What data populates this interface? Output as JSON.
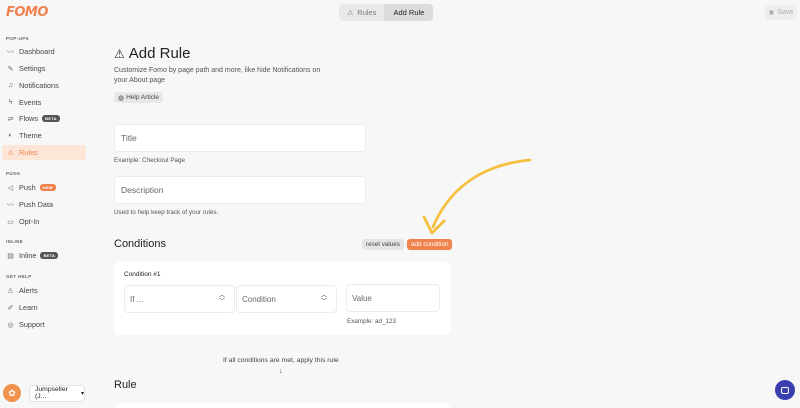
{
  "brand": {
    "logo": "FOMO",
    "accent": "#f0824e"
  },
  "sidebar": {
    "sections": [
      {
        "label": "POP-UPS",
        "items": [
          {
            "label": "Dashboard",
            "icon": "chart-line-icon"
          },
          {
            "label": "Settings",
            "icon": "pencil-icon"
          },
          {
            "label": "Notifications",
            "icon": "bell-icon"
          },
          {
            "label": "Events",
            "icon": "bolt-icon"
          },
          {
            "label": "Flows",
            "icon": "flow-icon",
            "badge": "BETA"
          },
          {
            "label": "Theme",
            "icon": "palette-icon"
          },
          {
            "label": "Rules",
            "icon": "warning-icon",
            "active": true
          }
        ]
      },
      {
        "label": "PUSH",
        "items": [
          {
            "label": "Push",
            "icon": "megaphone-icon",
            "badge": "NEW"
          },
          {
            "label": "Push Data",
            "icon": "chart-line-icon"
          },
          {
            "label": "Opt-In",
            "icon": "window-icon"
          }
        ]
      },
      {
        "label": "INLINE",
        "items": [
          {
            "label": "Inline",
            "icon": "inline-icon",
            "badge": "BETA"
          }
        ]
      },
      {
        "label": "GET HELP",
        "items": [
          {
            "label": "Alerts",
            "icon": "alert-icon"
          },
          {
            "label": "Learn",
            "icon": "book-icon"
          },
          {
            "label": "Support",
            "icon": "support-icon"
          }
        ]
      }
    ],
    "account": {
      "name": "Jumpseller (J..."
    }
  },
  "topbar": {
    "breadcrumb": [
      {
        "label": "Rules"
      },
      {
        "label": "Add Rule"
      }
    ],
    "save_label": "Save"
  },
  "main": {
    "title": "Add Rule",
    "subtitle": "Customize Fomo by page path and more, like hide Notifications on your About page",
    "help_label": "Help Article",
    "title_field": {
      "placeholder": "Title",
      "hint": "Example: Checkout Page"
    },
    "description_field": {
      "placeholder": "Description",
      "hint": "Used to help keep track of your rules."
    },
    "conditions": {
      "heading": "Conditions",
      "reset_label": "reset values",
      "add_label": "add condition",
      "items": [
        {
          "label": "Condition #1",
          "if_placeholder": "If ...",
          "condition_placeholder": "Condition",
          "value_placeholder": "Value",
          "value_hint": "Example: ad_123"
        }
      ],
      "apply_note": "If all conditions are met, apply this rule"
    },
    "rule_heading": "Rule"
  }
}
